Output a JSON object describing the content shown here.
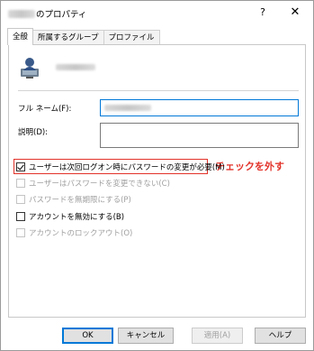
{
  "window": {
    "title_suffix": "のプロパティ",
    "help_symbol": "?",
    "close_symbol": "✕"
  },
  "tabs": [
    {
      "label": "全般",
      "active": true
    },
    {
      "label": "所属するグループ",
      "active": false
    },
    {
      "label": "プロファイル",
      "active": false
    }
  ],
  "general": {
    "full_name_label": "フル ネーム(F):",
    "description_label": "説明(D):",
    "checkboxes": [
      {
        "label": "ユーザーは次回ログオン時にパスワードの変更が必要(M)",
        "checked": true,
        "enabled": true
      },
      {
        "label": "ユーザーはパスワードを変更できない(C)",
        "checked": false,
        "enabled": false
      },
      {
        "label": "パスワードを無期限にする(P)",
        "checked": false,
        "enabled": false
      },
      {
        "label": "アカウントを無効にする(B)",
        "checked": false,
        "enabled": true
      },
      {
        "label": "アカウントのロックアウト(O)",
        "checked": false,
        "enabled": false
      }
    ]
  },
  "annotation": {
    "text": "チェックを外す",
    "color": "#e2332a"
  },
  "buttons": {
    "ok": "OK",
    "cancel": "キャンセル",
    "apply": "適用(A)",
    "help": "ヘルプ"
  },
  "colors": {
    "focus": "#0078d7",
    "highlight": "#e2332a"
  }
}
